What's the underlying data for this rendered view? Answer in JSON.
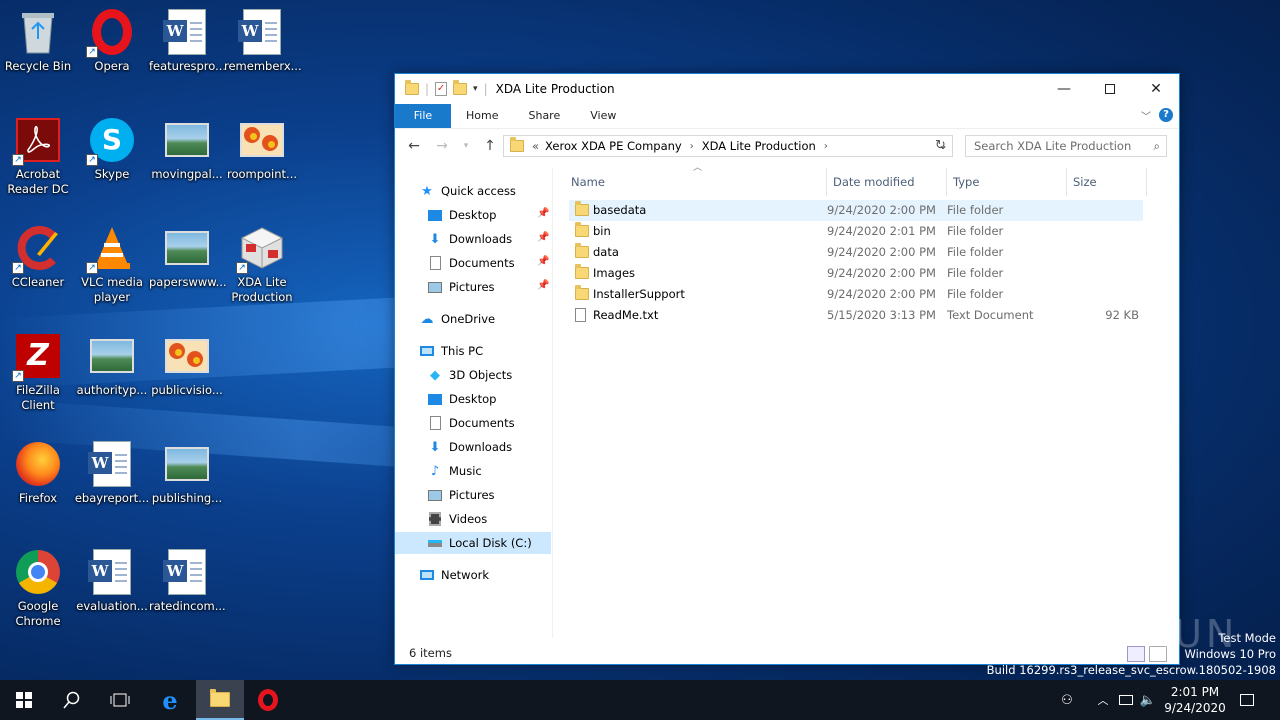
{
  "desktop": {
    "icons": [
      {
        "label": "Recycle Bin",
        "icon": "recycle-bin-icon"
      },
      {
        "label": "Opera",
        "icon": "opera-icon"
      },
      {
        "label": "featurespro...",
        "icon": "word-document-icon"
      },
      {
        "label": "rememberx...",
        "icon": "word-document-icon"
      },
      {
        "label": "Acrobat Reader DC",
        "icon": "acrobat-icon"
      },
      {
        "label": "Skype",
        "icon": "skype-icon"
      },
      {
        "label": "movingpal...",
        "icon": "image-file-icon"
      },
      {
        "label": "roompoint...",
        "icon": "image-file-icon"
      },
      {
        "label": "CCleaner",
        "icon": "ccleaner-icon"
      },
      {
        "label": "VLC media player",
        "icon": "vlc-icon"
      },
      {
        "label": "paperswww...",
        "icon": "image-file-icon"
      },
      {
        "label": "XDA Lite Production",
        "icon": "xda-icon"
      },
      {
        "label": "FileZilla Client",
        "icon": "filezilla-icon"
      },
      {
        "label": "authorityp...",
        "icon": "image-file-icon"
      },
      {
        "label": "publicvisio...",
        "icon": "image-file-icon"
      },
      {
        "label": "Firefox",
        "icon": "firefox-icon"
      },
      {
        "label": "ebayreport...",
        "icon": "word-document-icon"
      },
      {
        "label": "publishing...",
        "icon": "image-file-icon"
      },
      {
        "label": "Google Chrome",
        "icon": "chrome-icon"
      },
      {
        "label": "evaluation...",
        "icon": "word-document-icon"
      },
      {
        "label": "ratedincom...",
        "icon": "word-document-icon"
      }
    ]
  },
  "explorer": {
    "title": "XDA Lite Production",
    "ribbon": {
      "file": "File",
      "home": "Home",
      "share": "Share",
      "view": "View",
      "help": "?"
    },
    "address": {
      "prefix": "«",
      "parts": [
        "Xerox XDA PE Company",
        "XDA Lite Production"
      ]
    },
    "search": {
      "placeholder": "Search XDA Lite Production"
    },
    "nav": {
      "quick_access": "Quick access",
      "qa_desktop": "Desktop",
      "qa_downloads": "Downloads",
      "qa_documents": "Documents",
      "qa_pictures": "Pictures",
      "onedrive": "OneDrive",
      "this_pc": "This PC",
      "objects3d": "3D Objects",
      "desktop": "Desktop",
      "documents": "Documents",
      "downloads": "Downloads",
      "music": "Music",
      "pictures": "Pictures",
      "videos": "Videos",
      "local_disk": "Local Disk (C:)",
      "network": "Network"
    },
    "columns": {
      "name": "Name",
      "date": "Date modified",
      "type": "Type",
      "size": "Size"
    },
    "files": [
      {
        "name": "basedata",
        "date": "9/24/2020 2:00 PM",
        "type": "File folder",
        "size": "",
        "kind": "folder"
      },
      {
        "name": "bin",
        "date": "9/24/2020 2:01 PM",
        "type": "File folder",
        "size": "",
        "kind": "folder"
      },
      {
        "name": "data",
        "date": "9/24/2020 2:00 PM",
        "type": "File folder",
        "size": "",
        "kind": "folder"
      },
      {
        "name": "Images",
        "date": "9/24/2020 2:00 PM",
        "type": "File folder",
        "size": "",
        "kind": "folder"
      },
      {
        "name": "InstallerSupport",
        "date": "9/24/2020 2:00 PM",
        "type": "File folder",
        "size": "",
        "kind": "folder"
      },
      {
        "name": "ReadMe.txt",
        "date": "5/15/2020 3:13 PM",
        "type": "Text Document",
        "size": "92 KB",
        "kind": "text"
      }
    ],
    "status": "6 items"
  },
  "watermark": "ANY RUN",
  "system_info": {
    "line1": "Test Mode",
    "line2": "Windows 10 Pro",
    "line3": "Build 16299.rs3_release_svc_escrow.180502-1908"
  },
  "taskbar": {
    "time": "2:01 PM",
    "date": "9/24/2020"
  },
  "colors": {
    "accent": "#1979ca",
    "selection": "#cce8ff",
    "folder": "#f8d775"
  }
}
